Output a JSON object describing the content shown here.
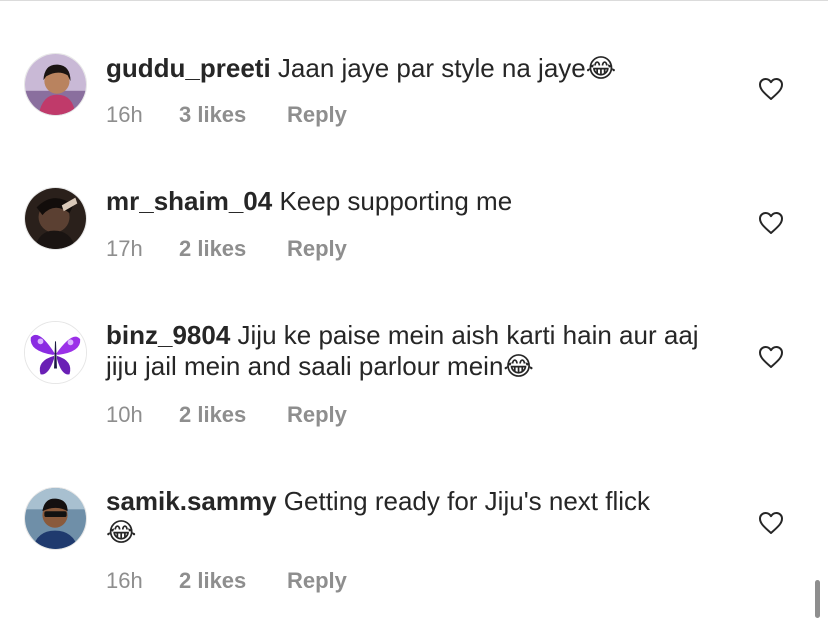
{
  "comments": [
    {
      "username": "guddu_preeti",
      "text": "Jaan jaye par style na jaye",
      "emoji": "😂",
      "time": "16h",
      "likes": "3 likes",
      "reply": "Reply",
      "avatar_icon": "woman-portrait-avatar"
    },
    {
      "username": "mr_shaim_04",
      "text": "Keep supporting me",
      "emoji": "",
      "time": "17h",
      "likes": "2 likes",
      "reply": "Reply",
      "avatar_icon": "man-dark-portrait-avatar"
    },
    {
      "username": "binz_9804",
      "text": "Jiju ke paise mein aish karti hain aur aaj jiju jail mein and saali parlour mein",
      "emoji": "😂",
      "time": "10h",
      "likes": "2 likes",
      "reply": "Reply",
      "avatar_icon": "purple-butterfly-avatar"
    },
    {
      "username": "samik.sammy",
      "text": "Getting ready for Jiju's next flick",
      "emoji": "😂",
      "time": "16h",
      "likes": "2 likes",
      "reply": "Reply",
      "avatar_icon": "man-sunglasses-avatar"
    }
  ],
  "icons": {
    "like": "heart-outline-icon"
  },
  "colors": {
    "text": "#262626",
    "secondary": "#8e8e8e",
    "divider": "#dbdbdb"
  }
}
